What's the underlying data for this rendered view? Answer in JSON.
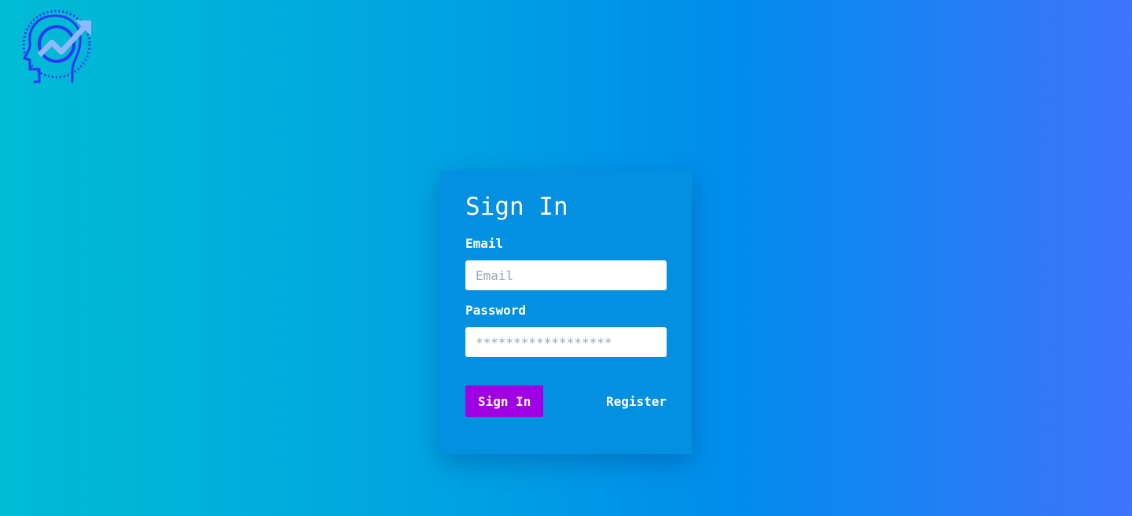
{
  "logo": {
    "icon": "head-growth-chart-icon",
    "colors": {
      "primary": "#2e39f0",
      "accent": "#8fb8ff"
    }
  },
  "login": {
    "title": "Sign In",
    "email_label": "Email",
    "email_placeholder": "Email",
    "email_value": "",
    "password_label": "Password",
    "password_placeholder": "******************",
    "password_value": "",
    "signin_label": "Sign In",
    "register_label": "Register"
  },
  "colors": {
    "card": "#0490e0",
    "button": "#a000e4"
  }
}
